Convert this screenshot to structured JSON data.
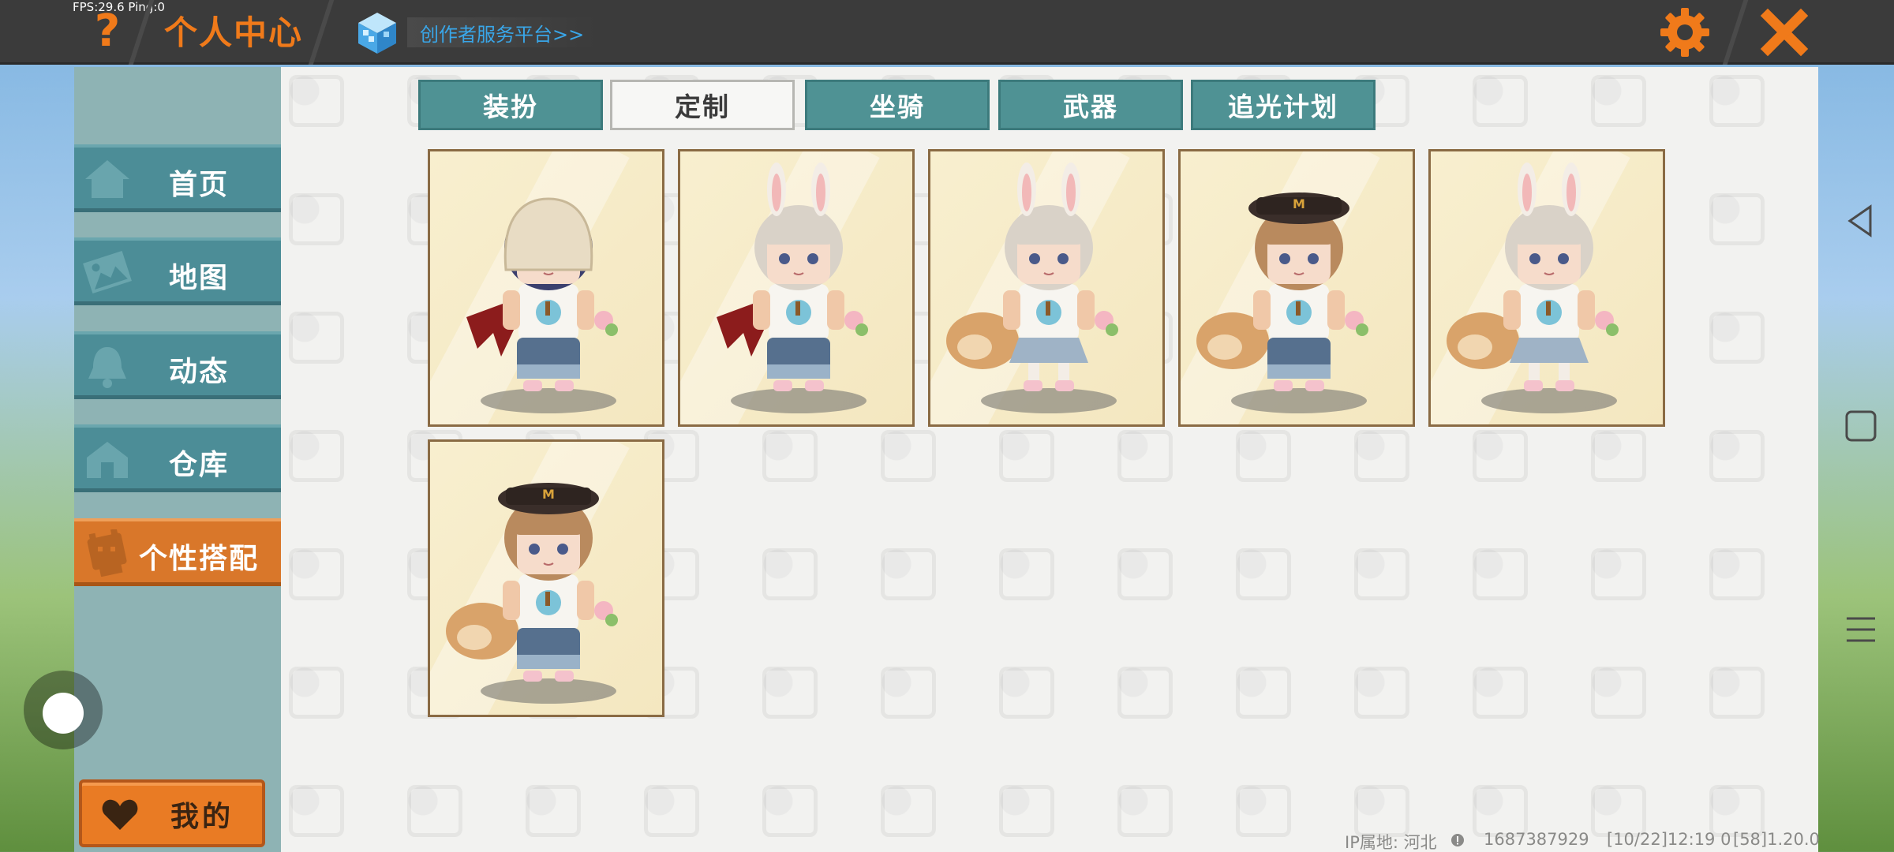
{
  "status": {
    "fps": "FPS:29.6  Ping:0"
  },
  "header": {
    "help_symbol": "?",
    "title": "个人中心",
    "creator_link": "创作者服务平台>>"
  },
  "sidebar": {
    "items": [
      {
        "label": "首页",
        "icon": "home-icon"
      },
      {
        "label": "地图",
        "icon": "map-icon"
      },
      {
        "label": "动态",
        "icon": "bell-icon"
      },
      {
        "label": "仓库",
        "icon": "house-icon"
      },
      {
        "label": "个性搭配",
        "icon": "character-icon",
        "active": true
      }
    ],
    "mine_button": "我的"
  },
  "tabs": [
    {
      "label": "装扮",
      "active": false
    },
    {
      "label": "定制",
      "active": true
    },
    {
      "label": "坐骑",
      "active": false
    },
    {
      "label": "武器",
      "active": false
    },
    {
      "label": "追光计划",
      "active": false
    }
  ],
  "outfits": [
    {
      "name": "hooded-bear-outfit",
      "hair": "#3b3f6e",
      "hat": "hood",
      "bottom": "pants",
      "extra": "wings"
    },
    {
      "name": "bunny-glasses-outfit",
      "hair": "#d9d2c8",
      "hat": "bunny",
      "bottom": "pants",
      "extra": "wings"
    },
    {
      "name": "bunny-vest-outfit",
      "hair": "#d9d2c8",
      "hat": "bunny",
      "bottom": "skirt",
      "extra": "tail"
    },
    {
      "name": "cap-vest-outfit",
      "hair": "#b98a5e",
      "hat": "cap",
      "bottom": "pants",
      "extra": "tail"
    },
    {
      "name": "bunny-skirt-outfit",
      "hair": "#d9d2c8",
      "hat": "bunny",
      "bottom": "skirt",
      "extra": "tail"
    },
    {
      "name": "cap-tail-outfit",
      "hair": "#b98a5e",
      "hat": "cap",
      "bottom": "pants",
      "extra": "tail"
    }
  ],
  "footer": {
    "ip_location": "IP属地: 河北",
    "user_id": "1687387929",
    "session": "[10/22]12:19 0",
    "version": "[58]1.20.0"
  },
  "colors": {
    "accent": "#f07a1a",
    "tab": "#4f9294",
    "sidebar_item": "#4c8d97",
    "sidebar_active": "#d9772a",
    "link": "#39a6e8"
  }
}
